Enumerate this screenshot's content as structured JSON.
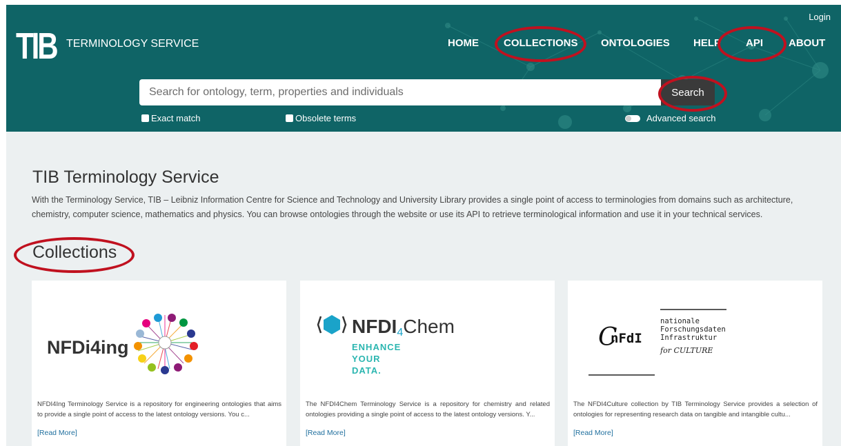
{
  "header": {
    "logo_mark": "TIB",
    "service_name": "TERMINOLOGY SERVICE",
    "login": "Login",
    "nav": [
      {
        "label": "HOME"
      },
      {
        "label": "COLLECTIONS"
      },
      {
        "label": "ONTOLOGIES"
      },
      {
        "label": "HELP"
      },
      {
        "label": "API"
      },
      {
        "label": "ABOUT"
      }
    ],
    "bg_color": "#0f6466"
  },
  "search": {
    "placeholder": "Search for ontology, term, properties and individuals",
    "value": "",
    "button": "Search",
    "exact_match": "Exact match",
    "obsolete_terms": "Obsolete terms",
    "advanced_search": "Advanced search"
  },
  "main": {
    "title": "TIB Terminology Service",
    "intro": "With the Terminology Service, TIB – Leibniz Information Centre for Science and Technology and University Library provides a single point of access to terminologies from domains such as architecture, chemistry, computer science, mathematics and physics. You can browse ontologies through the website or use its API to retrieve terminological information and use it in your technical services.",
    "collections_heading": "Collections",
    "cards": [
      {
        "logo_text": "NFDi4ing",
        "description": "NFDI4Ing Terminology Service is a repository for engineering ontologies that aims to provide a single point of access to the latest ontology versions. You c...",
        "read_more": "[Read More]"
      },
      {
        "logo_text_main": "NFDI",
        "logo_text_sub": "4",
        "logo_text_tail": "Chem",
        "tagline": [
          "ENHANCE",
          "YOUR",
          "DATA."
        ],
        "description": "The NFDI4Chem Terminology Service is a repository for chemistry and related ontologies providing a single point of access to the latest ontology versions. Y...",
        "read_more": "[Read More]"
      },
      {
        "logo_text": "nFdI",
        "logo_lines": [
          "nationale",
          "Forschungsdaten",
          "Infrastruktur"
        ],
        "logo_for": "for CULTURE",
        "description": "The NFDI4Culture collection by TIB Terminology Service provides a selection of ontologies for representing research data on tangible and intangible cultu...",
        "read_more": "[Read More]"
      }
    ]
  },
  "colors": {
    "accent": "#0f6466",
    "highlight_ring": "#c0111f",
    "link": "#1f6f9e",
    "page_bg": "#ecf0f1"
  }
}
